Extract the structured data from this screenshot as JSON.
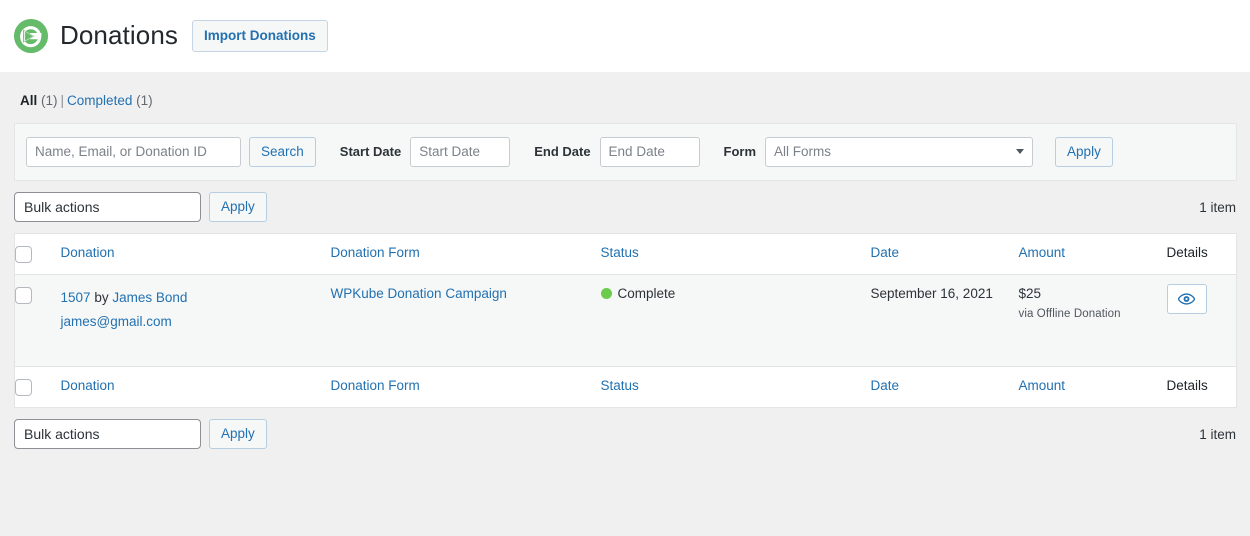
{
  "header": {
    "logo_icon": "givewp-logo-icon",
    "title": "Donations",
    "import_button": "Import Donations"
  },
  "views": [
    {
      "label": "All",
      "count": "(1)",
      "current": true
    },
    {
      "label": "Completed",
      "count": "(1)",
      "current": false
    }
  ],
  "filters": {
    "search_placeholder": "Name, Email, or Donation ID",
    "search_value": "",
    "search_button": "Search",
    "start_date_label": "Start Date",
    "start_date_placeholder": "Start Date",
    "start_date_value": "",
    "end_date_label": "End Date",
    "end_date_placeholder": "End Date",
    "end_date_value": "",
    "form_label": "Form",
    "form_selected": "All Forms",
    "form_options": [
      "All Forms"
    ],
    "apply_button": "Apply"
  },
  "tablenav_top": {
    "bulk_selected": "Bulk actions",
    "bulk_options": [
      "Bulk actions"
    ],
    "apply_button": "Apply",
    "item_count": "1 item"
  },
  "tablenav_bottom": {
    "bulk_selected": "Bulk actions",
    "bulk_options": [
      "Bulk actions"
    ],
    "apply_button": "Apply",
    "item_count": "1 item"
  },
  "table": {
    "columns": [
      {
        "key": "cb",
        "label": "",
        "sortable": false
      },
      {
        "key": "donation",
        "label": "Donation",
        "sortable": true
      },
      {
        "key": "form",
        "label": "Donation Form",
        "sortable": true
      },
      {
        "key": "status",
        "label": "Status",
        "sortable": true
      },
      {
        "key": "date",
        "label": "Date",
        "sortable": true
      },
      {
        "key": "amount",
        "label": "Amount",
        "sortable": true
      },
      {
        "key": "details",
        "label": "Details",
        "sortable": false
      }
    ],
    "rows": [
      {
        "donation_id": "1507",
        "donation_by": "by",
        "donor_name": "James Bond",
        "donor_email": "james@gmail.com",
        "form_name": "WPKube Donation Campaign",
        "status": "Complete",
        "status_color": "#6bcb4b",
        "date": "September 16, 2021",
        "amount": "$25",
        "gateway": "via Offline Donation",
        "details_icon": "eye-icon"
      }
    ]
  },
  "colors": {
    "link": "#2271b1",
    "brand_green": "#66bb6a",
    "status_green": "#6bcb4b",
    "page_bg": "#f0f0f1",
    "row_bg": "#f6f7f7"
  }
}
